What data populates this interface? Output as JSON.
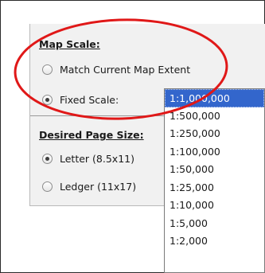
{
  "colors": {
    "highlight_ellipse": "#e01818",
    "selected_item_bg": "#3366cc",
    "panel_bg": "#f1f1f1"
  },
  "map_scale": {
    "heading": "Map Scale:",
    "options": [
      {
        "label": "Match Current Map Extent",
        "checked": false
      },
      {
        "label": "Fixed Scale:",
        "checked": true
      }
    ]
  },
  "page_size": {
    "heading": "Desired Page Size:",
    "options": [
      {
        "label": "Letter (8.5x11)",
        "checked": true
      },
      {
        "label": "Ledger (11x17)",
        "checked": false
      }
    ]
  },
  "scale_dropdown": {
    "selected": "1:1,000,000",
    "options": [
      "1:1,000,000",
      "1:500,000",
      "1:250,000",
      "1:100,000",
      "1:50,000",
      "1:25,000",
      "1:10,000",
      "1:5,000",
      "1:2,000"
    ]
  }
}
